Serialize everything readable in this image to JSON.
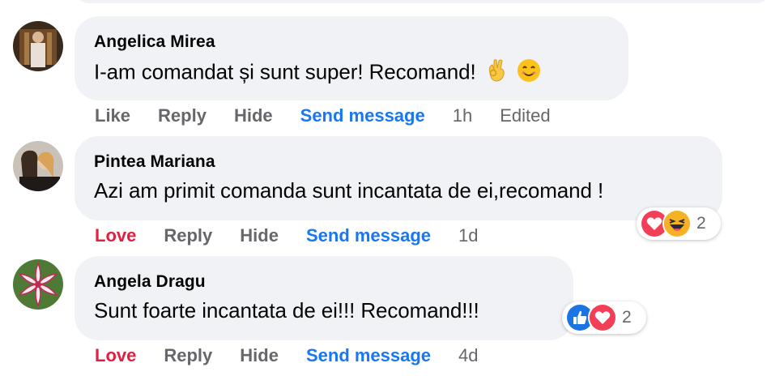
{
  "comments": [
    {
      "author": "Angelica Mirea",
      "text": "I-am comandat și sunt super! Recomand!",
      "emojis": [
        "ok-hand-icon",
        "smiling-face-icon"
      ],
      "actions": {
        "react": "Like",
        "reply": "Reply",
        "hide": "Hide",
        "send": "Send message",
        "time": "1h",
        "edited": "Edited"
      }
    },
    {
      "author": "Pintea Mariana",
      "text": "Azi am primit comanda sunt incantata de ei,recomand !",
      "actions": {
        "react": "Love",
        "reply": "Reply",
        "hide": "Hide",
        "send": "Send message",
        "time": "1d"
      },
      "reactions": {
        "icons": [
          "love-icon",
          "haha-icon"
        ],
        "count": "2"
      }
    },
    {
      "author": "Angela Dragu",
      "text": "Sunt foarte incantata de ei!!! Recomand!!!",
      "actions": {
        "react": "Love",
        "reply": "Reply",
        "hide": "Hide",
        "send": "Send message",
        "time": "4d"
      },
      "reactions": {
        "icons": [
          "like-icon",
          "love-icon"
        ],
        "count": "2"
      }
    }
  ],
  "colors": {
    "bubble": "#f0f2f5",
    "link_blue": "#1877f2",
    "love_red": "#e41e3f",
    "meta_gray": "#65676b"
  }
}
